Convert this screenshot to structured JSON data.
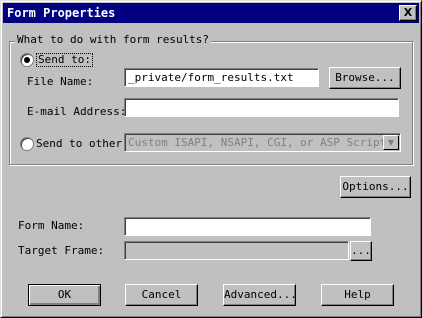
{
  "window": {
    "title": "Form Properties",
    "close_label": "X"
  },
  "group": {
    "legend": "What to do with form results?"
  },
  "send_to": {
    "label": "Send to:",
    "selected": true
  },
  "file_name": {
    "label": "File Name:",
    "value": "_private/form_results.txt"
  },
  "browse_button": {
    "label": "Browse..."
  },
  "email": {
    "label": "E-mail Address:",
    "value": ""
  },
  "send_to_other": {
    "label": "Send to other:",
    "selected_option": "Custom ISAPI, NSAPI, CGI, or ASP Script"
  },
  "options_button": {
    "label": "Options..."
  },
  "form_name": {
    "label": "Form Name:",
    "value": ""
  },
  "target_frame": {
    "label": "Target Frame:",
    "value": "",
    "button_label": "..."
  },
  "buttons": {
    "ok": "OK",
    "cancel": "Cancel",
    "advanced": "Advanced...",
    "help": "Help"
  }
}
